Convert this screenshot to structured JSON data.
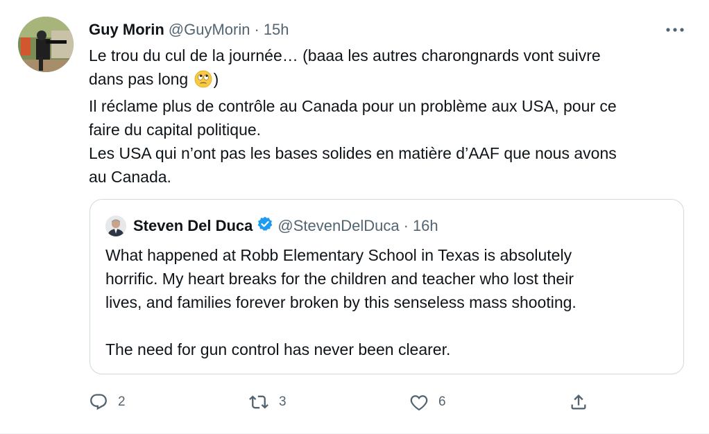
{
  "tweet": {
    "author_name": "Guy Morin",
    "handle": "@GuyMorin",
    "separator": "·",
    "time": "15h",
    "text_lines": [
      "Le trou du cul de la journée… (baaa les autres charongnards vont suivre",
      "dans pas long",
      ")",
      "Il réclame plus de contrôle au Canada pour un problème aux USA, pour ce",
      "faire du capital politique.",
      "Les USA qui n’ont pas les bases solides en matière d’AAF que nous avons",
      "au Canada."
    ],
    "emoji": "face-with-rolling-eyes"
  },
  "quote": {
    "author_name": "Steven Del Duca",
    "verified": true,
    "handle": "@StevenDelDuca",
    "separator": "·",
    "time": "16h",
    "paragraph1": [
      "What happened at Robb Elementary School in Texas is absolutely",
      "horrific. My heart breaks for the children and teacher who lost their",
      "lives, and families forever broken by this senseless mass shooting."
    ],
    "paragraph2": "The need for gun control has never been clearer."
  },
  "actions": {
    "reply_count": "2",
    "retweet_count": "3",
    "like_count": "6"
  },
  "colors": {
    "text": "#0f1419",
    "muted": "#536471",
    "border": "#cfd9de",
    "verified": "#1d9bf0"
  },
  "icons": [
    "more-icon",
    "verified-badge-icon",
    "reply-icon",
    "retweet-icon",
    "like-icon",
    "share-icon"
  ]
}
